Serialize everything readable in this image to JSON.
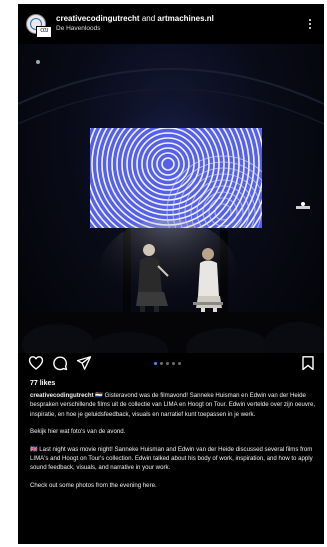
{
  "post": {
    "author": "creativecodingutrecht",
    "conjunction": "and",
    "coauthor": "artmachines.nl",
    "location": "De Havenloods",
    "avatar_logo_text": "CCU",
    "more_icon": "more-vertical-icon",
    "likes": "77 likes",
    "carousel": {
      "count": 5,
      "active_index": 0
    },
    "actions": [
      "heart-icon",
      "comment-icon",
      "share-icon",
      "bookmark-icon"
    ],
    "caption": {
      "flag_nl": "🇳🇱",
      "nl_text": "Gisteravond was de filmavond! Sanneke Huisman en Edwin van der Heide bespraken verschillende films uit de collectie van LIMA en Hoogt on Tour. Edwin vertelde over zijn oeuvre, inspiratie, en hoe je geluidsfeedback, visuals en narratief kunt toepassen in je werk.",
      "nl_photos": "Bekijk hier wat foto's van de avond.",
      "flag_uk": "🇬🇧",
      "en_text": "Last night was movie night! Sanneke Huisman and Edwin van der Heide discussed several films from LIMA's and Hoogt on Tour's collection. Edwin talked about his body of work, inspiration, and how to apply sound feedback, visuals, and narrative in your work.",
      "en_photos": "Check out some photos from the evening here."
    }
  },
  "colors": {
    "background": "#000000",
    "accent": "#3897f0",
    "text": "#ffffff"
  }
}
